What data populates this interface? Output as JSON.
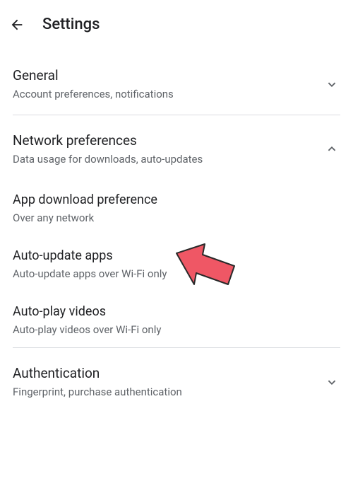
{
  "header": {
    "title": "Settings"
  },
  "sections": {
    "general": {
      "title": "General",
      "subtitle": "Account preferences, notifications"
    },
    "network": {
      "title": "Network preferences",
      "subtitle": "Data usage for downloads, auto-updates"
    },
    "appDownload": {
      "title": "App download preference",
      "subtitle": "Over any network"
    },
    "autoUpdate": {
      "title": "Auto-update apps",
      "subtitle": "Auto-update apps over Wi-Fi only"
    },
    "autoPlay": {
      "title": "Auto-play videos",
      "subtitle": "Auto-play videos over Wi-Fi only"
    },
    "authentication": {
      "title": "Authentication",
      "subtitle": "Fingerprint, purchase authentication"
    }
  }
}
